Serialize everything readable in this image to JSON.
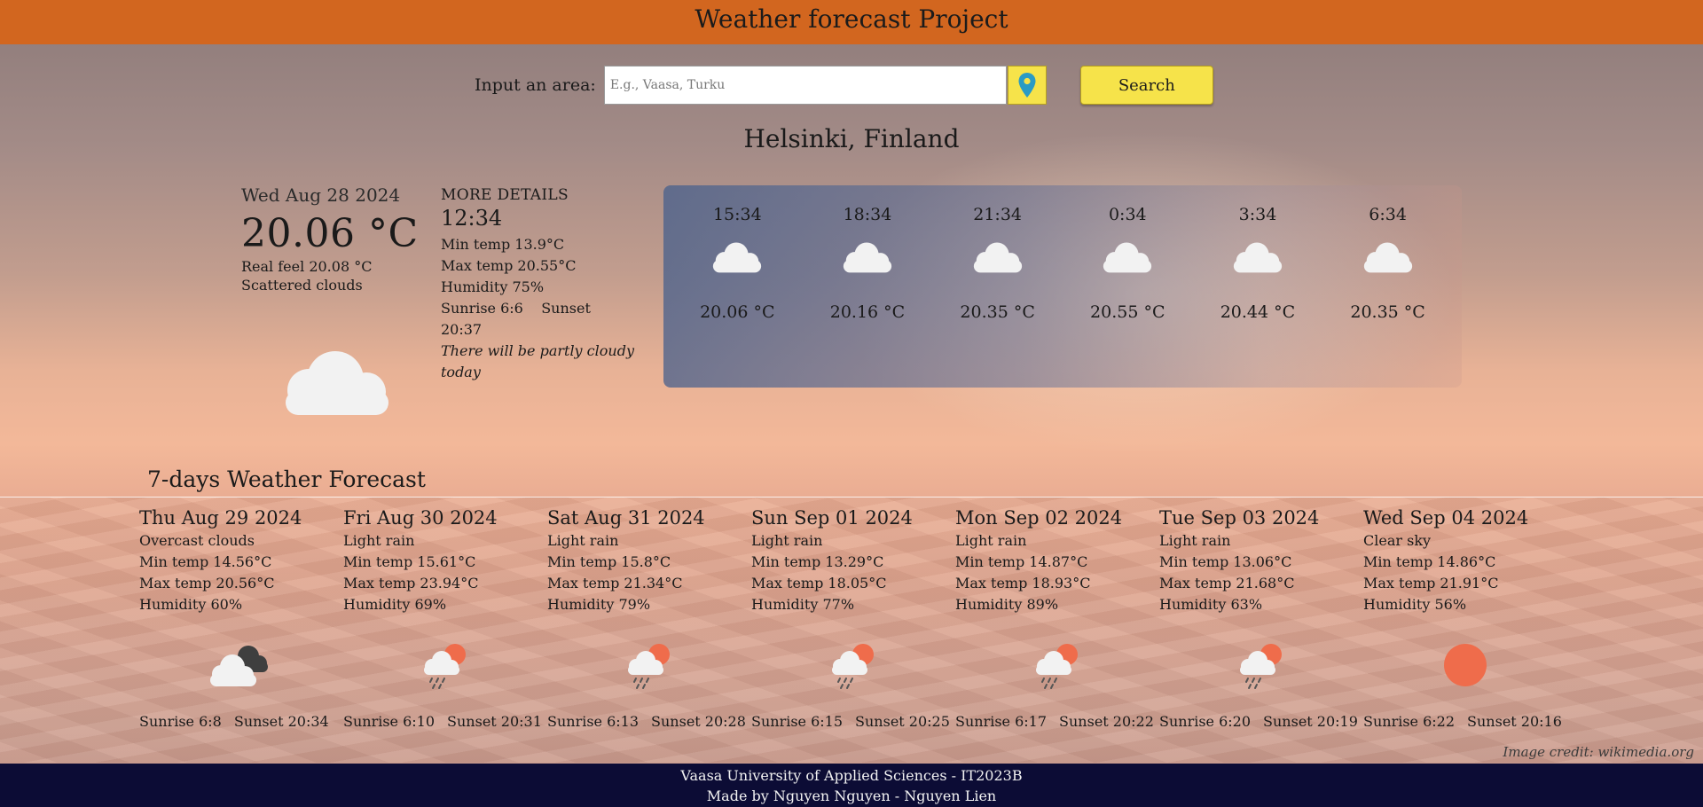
{
  "header": {
    "title": "Weather forecast Project"
  },
  "search": {
    "label": "Input an area:",
    "placeholder": "E.g., Vaasa, Turku",
    "value": "",
    "button_label": "Search",
    "location_icon": "map-pin-icon"
  },
  "location": "Helsinki, Finland",
  "current": {
    "date": "Wed Aug 28 2024",
    "temp": "20.06 °C",
    "real_feel": "Real feel 20.08 °C",
    "condition": "Scattered clouds",
    "icon": "cloud-icon"
  },
  "details": {
    "heading": "MORE DETAILS",
    "time": "12:34",
    "min_temp": "Min temp 13.9°C",
    "max_temp": "Max temp 20.55°C",
    "humidity": "Humidity 75%",
    "sunrise": "Sunrise 6:6",
    "sunset": "Sunset 20:37",
    "description": "There will be partly cloudy today"
  },
  "hourly": [
    {
      "time": "15:34",
      "temp": "20.06 °C",
      "icon": "cloud-icon"
    },
    {
      "time": "18:34",
      "temp": "20.16 °C",
      "icon": "cloud-icon"
    },
    {
      "time": "21:34",
      "temp": "20.35 °C",
      "icon": "cloud-icon"
    },
    {
      "time": "0:34",
      "temp": "20.55 °C",
      "icon": "cloud-icon"
    },
    {
      "time": "3:34",
      "temp": "20.44 °C",
      "icon": "cloud-icon"
    },
    {
      "time": "6:34",
      "temp": "20.35 °C",
      "icon": "cloud-icon"
    }
  ],
  "week": {
    "title": "7-days Weather Forecast",
    "days": [
      {
        "date": "Thu Aug 29 2024",
        "condition": "Overcast clouds",
        "min": "Min temp 14.56°C",
        "max": "Max temp 20.56°C",
        "humidity": "Humidity 60%",
        "sunrise": "Sunrise 6:8",
        "sunset": "Sunset 20:34",
        "icon": "overcast-clouds-icon"
      },
      {
        "date": "Fri Aug 30 2024",
        "condition": "Light rain",
        "min": "Min temp 15.61°C",
        "max": "Max temp 23.94°C",
        "humidity": "Humidity 69%",
        "sunrise": "Sunrise 6:10",
        "sunset": "Sunset 20:31",
        "icon": "sun-rain-icon"
      },
      {
        "date": "Sat Aug 31 2024",
        "condition": "Light rain",
        "min": "Min temp 15.8°C",
        "max": "Max temp 21.34°C",
        "humidity": "Humidity 79%",
        "sunrise": "Sunrise 6:13",
        "sunset": "Sunset 20:28",
        "icon": "sun-rain-icon"
      },
      {
        "date": "Sun Sep 01 2024",
        "condition": "Light rain",
        "min": "Min temp 13.29°C",
        "max": "Max temp 18.05°C",
        "humidity": "Humidity 77%",
        "sunrise": "Sunrise 6:15",
        "sunset": "Sunset 20:25",
        "icon": "sun-rain-icon"
      },
      {
        "date": "Mon Sep 02 2024",
        "condition": "Light rain",
        "min": "Min temp 14.87°C",
        "max": "Max temp 18.93°C",
        "humidity": "Humidity 89%",
        "sunrise": "Sunrise 6:17",
        "sunset": "Sunset 20:22",
        "icon": "sun-rain-icon"
      },
      {
        "date": "Tue Sep 03 2024",
        "condition": "Light rain",
        "min": "Min temp 13.06°C",
        "max": "Max temp 21.68°C",
        "humidity": "Humidity 63%",
        "sunrise": "Sunrise 6:20",
        "sunset": "Sunset 20:19",
        "icon": "sun-rain-icon"
      },
      {
        "date": "Wed Sep 04 2024",
        "condition": "Clear sky",
        "min": "Min temp 14.86°C",
        "max": "Max temp 21.91°C",
        "humidity": "Humidity 56%",
        "sunrise": "Sunrise 6:22",
        "sunset": "Sunset 20:16",
        "icon": "sun-icon"
      }
    ]
  },
  "image_credit": "Image credit: wikimedia.org",
  "footer": {
    "line1": "Vaasa University of Applied Sciences - IT2023B",
    "line2": "Made by Nguyen Nguyen - Nguyen Lien"
  },
  "colors": {
    "header_bg": "#d2661f",
    "button_yellow": "#f6e34a",
    "footer_bg": "#0c0c35",
    "sun": "#ef6c4b",
    "cloud": "#f2f2f2",
    "dark_cloud": "#444444",
    "pin": "#2a9bc4"
  }
}
